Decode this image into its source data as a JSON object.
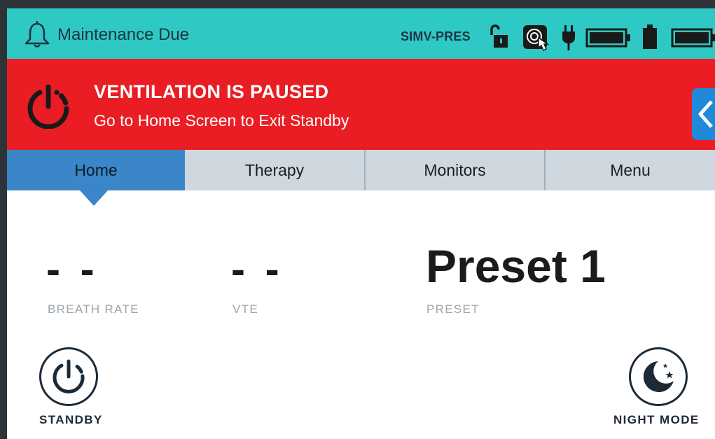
{
  "status_bar": {
    "message": "Maintenance Due",
    "mode": "SIMV-PRES",
    "icons": [
      "bell-icon",
      "unlock-icon",
      "touch-lock-icon",
      "ac-power-icon",
      "battery-full-icon",
      "battery-small-icon",
      "battery-full-icon-2"
    ],
    "color": "#2ec9c4"
  },
  "alarm_banner": {
    "title": "VENTILATION IS PAUSED",
    "subtitle": "Go to Home Screen to Exit Standby",
    "color": "#e91d23",
    "icon": "power-icon",
    "collapse_icon": "chevron-left-icon"
  },
  "tabs": [
    {
      "label": "Home",
      "active": true
    },
    {
      "label": "Therapy",
      "active": false
    },
    {
      "label": "Monitors",
      "active": false
    },
    {
      "label": "Menu",
      "active": false
    }
  ],
  "readouts": {
    "breath_rate": {
      "value": "- -",
      "label": "BREATH RATE"
    },
    "vte": {
      "value": "- -",
      "label": "VTE"
    },
    "preset": {
      "value": "Preset 1",
      "label": "PRESET"
    }
  },
  "buttons": {
    "standby": {
      "label": "STANDBY",
      "icon": "power-icon"
    },
    "night_mode": {
      "label": "NIGHT MODE",
      "icon": "moon-stars-icon"
    }
  },
  "colors": {
    "active_tab": "#3a86c8",
    "inactive_tab": "#cfd8df"
  }
}
